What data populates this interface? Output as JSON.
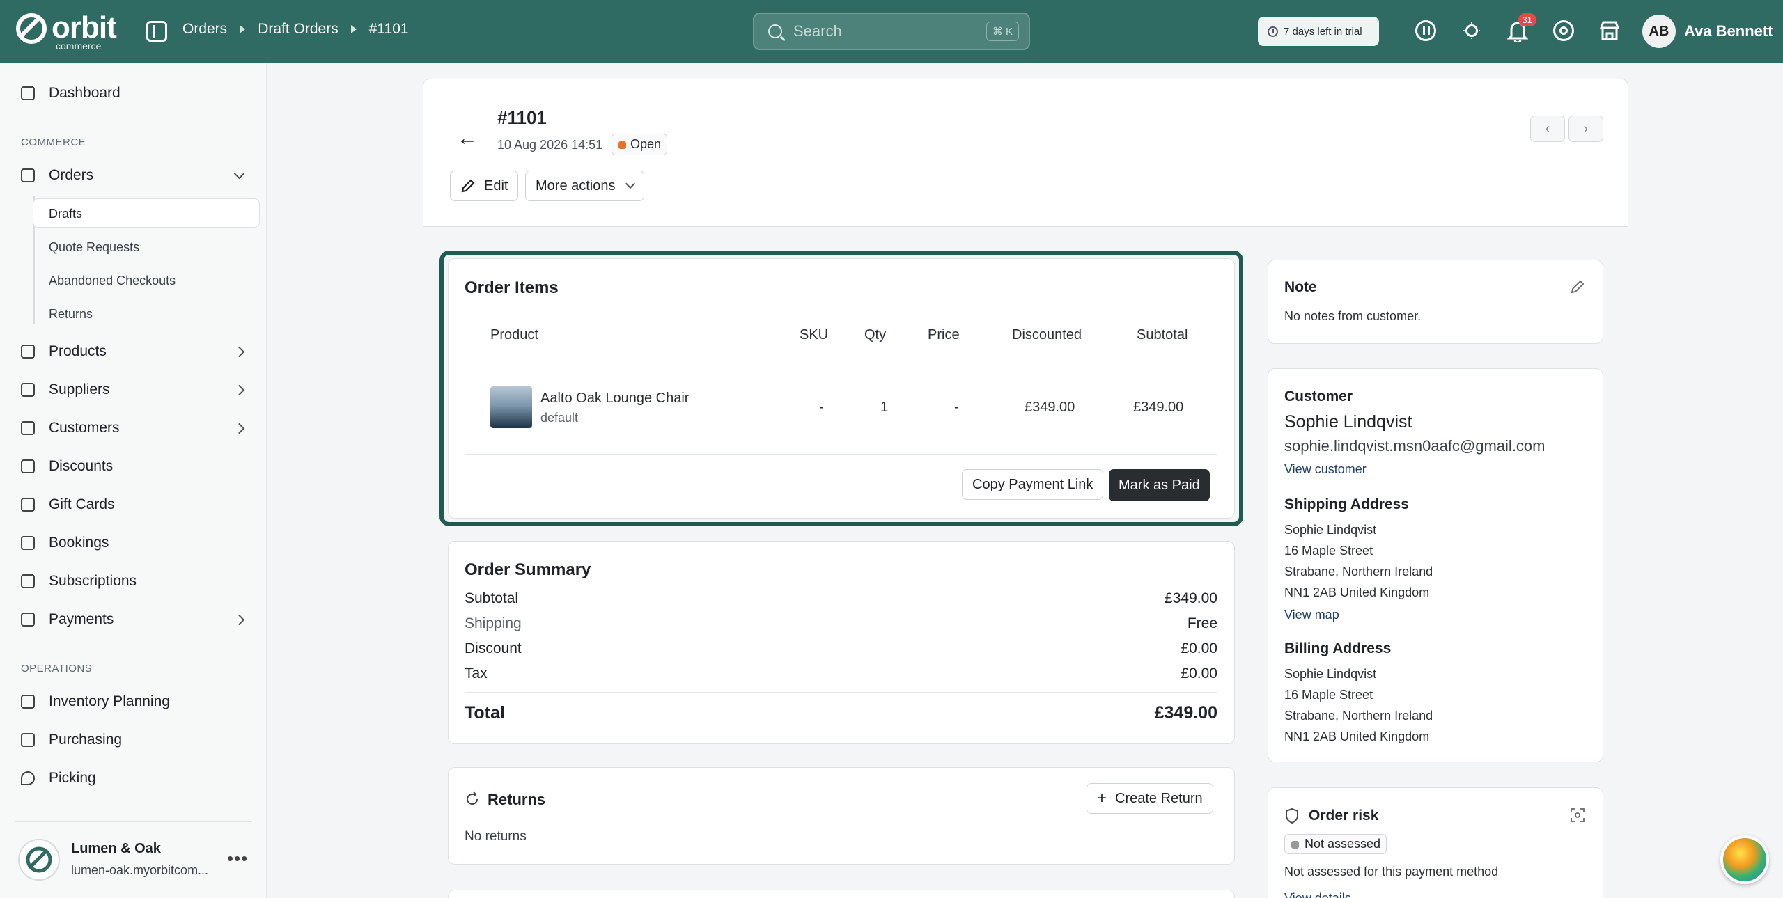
{
  "brand": {
    "name": "orbit",
    "sub": "commerce"
  },
  "breadcrumb": [
    "Orders",
    "Draft Orders",
    "#1101"
  ],
  "search": {
    "placeholder": "Search",
    "shortcut": "⌘ K"
  },
  "trial": "7 days left in trial",
  "notifications": {
    "count": "31"
  },
  "user": {
    "initials": "AB",
    "name": "Ava Bennett"
  },
  "sidebar": {
    "dashboard": "Dashboard",
    "section_commerce": "COMMERCE",
    "orders": "Orders",
    "orders_sub": [
      "Drafts",
      "Quote Requests",
      "Abandoned Checkouts",
      "Returns"
    ],
    "products": "Products",
    "suppliers": "Suppliers",
    "customers": "Customers",
    "discounts": "Discounts",
    "giftcards": "Gift Cards",
    "bookings": "Bookings",
    "subscriptions": "Subscriptions",
    "payments": "Payments",
    "section_operations": "OPERATIONS",
    "inventory": "Inventory Planning",
    "purchasing": "Purchasing",
    "picking": "Picking"
  },
  "store": {
    "name": "Lumen & Oak",
    "url": "lumen-oak.myorbitcom..."
  },
  "order": {
    "title": "#1101",
    "date": "10 Aug 2026 14:51",
    "status": "Open",
    "edit": "Edit",
    "more_actions": "More actions"
  },
  "items": {
    "title": "Order Items",
    "columns": [
      "Product",
      "SKU",
      "Qty",
      "Price",
      "Discounted",
      "Subtotal"
    ],
    "rows": [
      {
        "name": "Aalto Oak Lounge Chair",
        "variant": "default",
        "sku": "-",
        "qty": "1",
        "price": "-",
        "discounted": "£349.00",
        "subtotal": "£349.00"
      }
    ],
    "copy_link": "Copy Payment Link",
    "mark_paid": "Mark as Paid"
  },
  "summary": {
    "title": "Order Summary",
    "subtotal_label": "Subtotal",
    "subtotal": "£349.00",
    "shipping_label": "Shipping",
    "shipping": "Free",
    "discount_label": "Discount",
    "discount": "£0.00",
    "tax_label": "Tax",
    "tax": "£0.00",
    "total_label": "Total",
    "total": "£349.00"
  },
  "returns": {
    "title": "Returns",
    "create": "Create Return",
    "empty": "No returns"
  },
  "note": {
    "title": "Note",
    "text": "No notes from customer."
  },
  "customer": {
    "title": "Customer",
    "name": "Sophie Lindqvist",
    "email": "sophie.lindqvist.msn0aafc@gmail.com",
    "view": "View customer",
    "shipping_title": "Shipping Address",
    "shipping": [
      "Sophie Lindqvist",
      "16 Maple Street",
      "Strabane, Northern Ireland",
      "NN1 2AB United Kingdom"
    ],
    "view_map": "View map",
    "billing_title": "Billing Address",
    "billing": [
      "Sophie Lindqvist",
      "16 Maple Street",
      "Strabane, Northern Ireland",
      "NN1 2AB United Kingdom"
    ]
  },
  "risk": {
    "title": "Order risk",
    "status": "Not assessed",
    "text": "Not assessed for this payment method",
    "details": "View details"
  },
  "colors": {
    "topbar": "#2f6b62",
    "focus": "#1f5b4f",
    "status_open": "#e8712b"
  }
}
